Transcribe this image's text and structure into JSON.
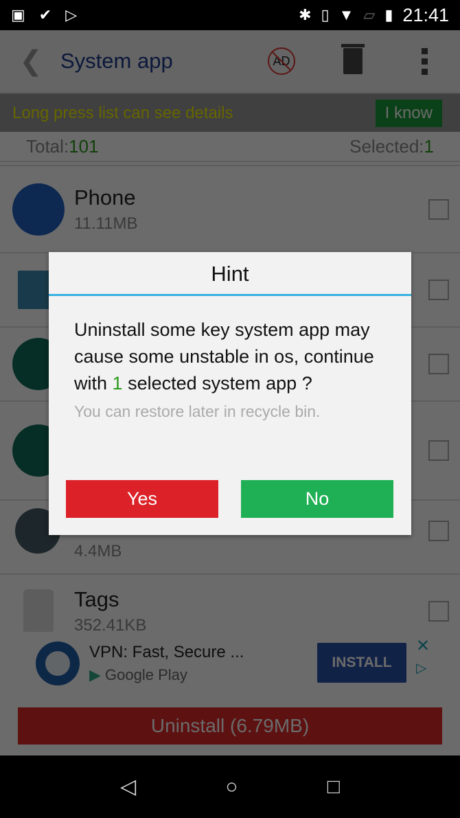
{
  "status_bar": {
    "time": "21:41",
    "left_icons": [
      "image-icon",
      "check-flag-icon",
      "play-store-icon"
    ],
    "right_icons": [
      "bluetooth-icon",
      "vibrate-icon",
      "wifi-icon",
      "no-sim-icon",
      "battery-icon"
    ]
  },
  "header": {
    "title": "System app",
    "back_icon": "chevron-left-icon",
    "no_ad_label": "AD"
  },
  "banner": {
    "text": "Long press list can see details",
    "button": "I know"
  },
  "totals": {
    "total_label": "Total: ",
    "total": "101",
    "selected_label": "Selected: ",
    "selected": "1"
  },
  "apps": [
    {
      "name": "Phone",
      "size": "11.11MB"
    },
    {
      "name": "",
      "size": ""
    },
    {
      "name": "",
      "size": ""
    },
    {
      "name": "",
      "size": ""
    },
    {
      "name": "",
      "size": "4.4MB"
    },
    {
      "name": "Tags",
      "size": "352.41KB"
    }
  ],
  "ad": {
    "title": "VPN: Fast, Secure ...",
    "store": "Google Play",
    "install": "INSTALL"
  },
  "uninstall_button": "Uninstall (6.79MB)",
  "dialog": {
    "title": "Hint",
    "msg_before": "Uninstall some key system app may cause some unstable in os, continue with ",
    "count": "1",
    "msg_after": " selected system app ?",
    "sub": "You can restore later in recycle bin.",
    "yes": "Yes",
    "no": "No"
  },
  "colors": {
    "accent_blue": "#36b0e0",
    "yes": "#dc2228",
    "no": "#1fb055",
    "title": "#1a3a8a"
  }
}
